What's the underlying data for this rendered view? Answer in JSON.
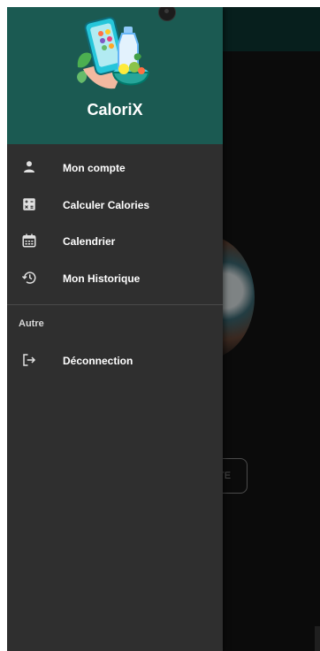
{
  "app": {
    "name": "CaloriX"
  },
  "drawer": {
    "items": [
      {
        "label": "Mon compte",
        "icon": "person-icon"
      },
      {
        "label": "Calculer Calories",
        "icon": "calculator-icon"
      },
      {
        "label": "Calendrier",
        "icon": "calendar-icon"
      },
      {
        "label": "Mon Historique",
        "icon": "history-icon"
      }
    ],
    "section_label": "Autre",
    "secondary_items": [
      {
        "label": "Déconnection",
        "icon": "logout-icon"
      }
    ]
  },
  "background": {
    "button_label": "TE"
  },
  "colors": {
    "header": "#1b5a52",
    "drawer": "#2f2f2f",
    "text": "#ffffff"
  }
}
